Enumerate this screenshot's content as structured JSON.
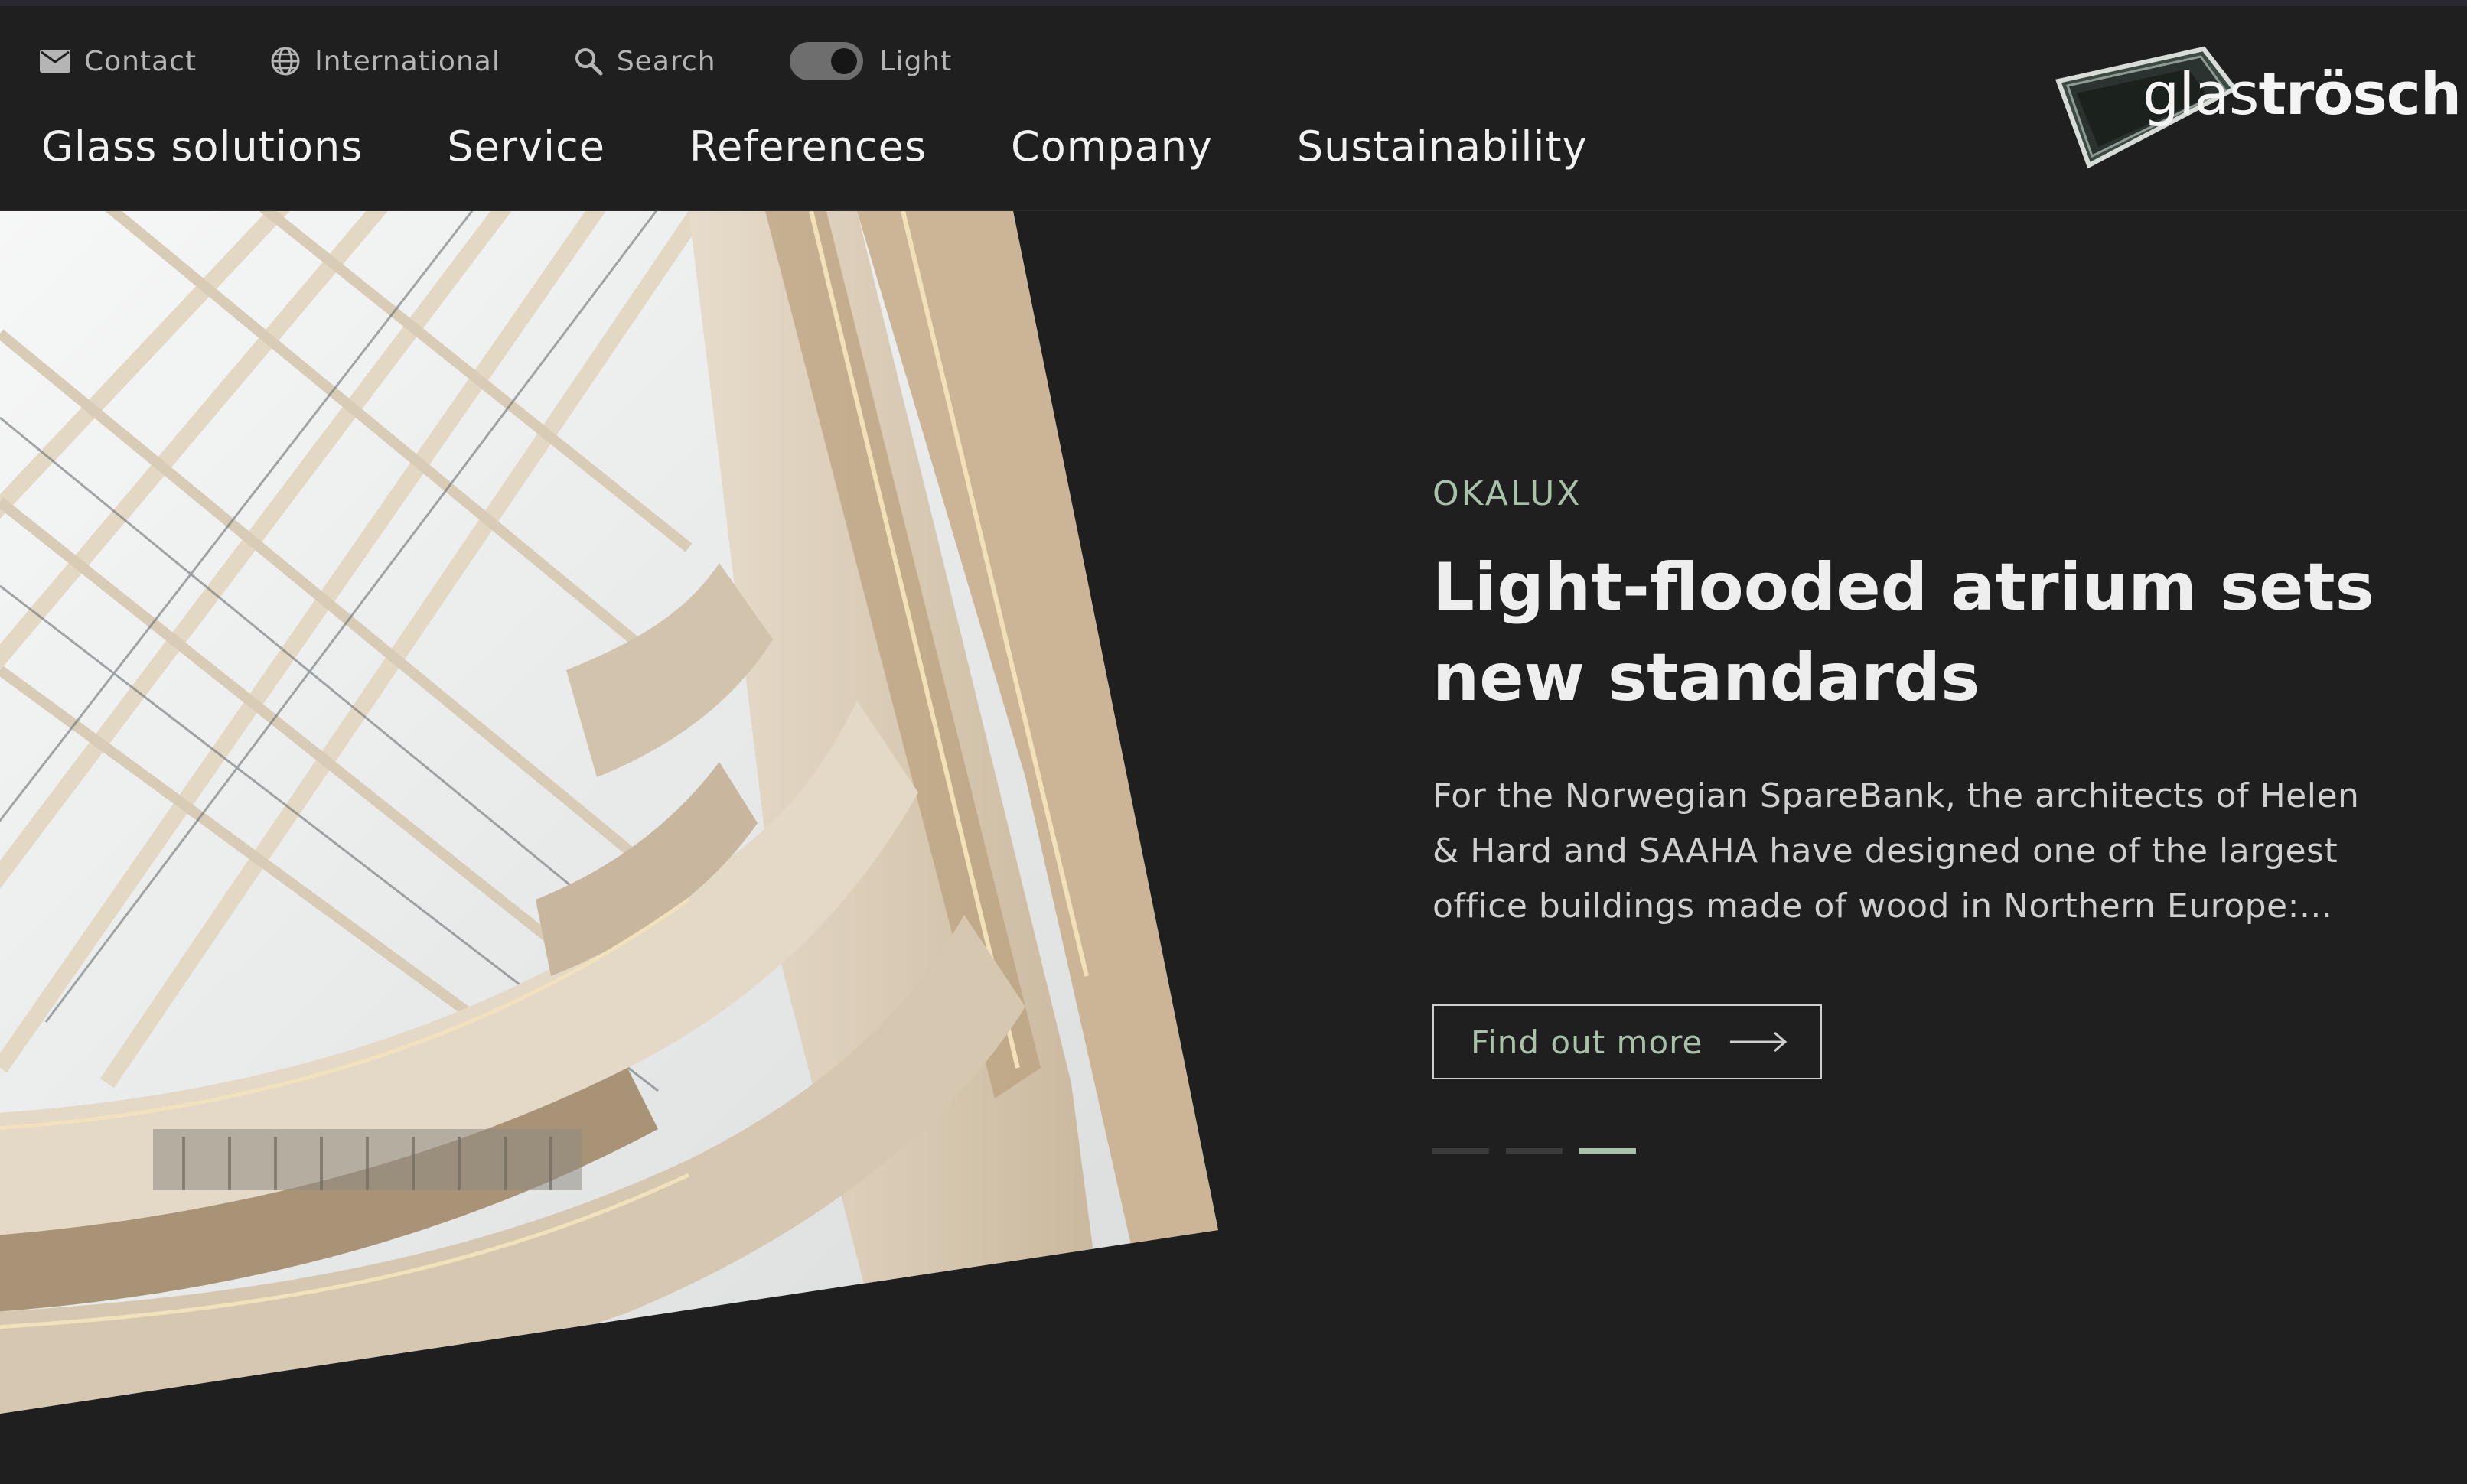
{
  "utility": {
    "contact_label": "Contact",
    "international_label": "International",
    "search_label": "Search",
    "theme_label": "Light"
  },
  "nav": {
    "items": [
      "Glass solutions",
      "Service",
      "References",
      "Company",
      "Sustainability"
    ]
  },
  "logo": {
    "part1": "glas",
    "part2": "trösch"
  },
  "hero": {
    "eyebrow": "OKALUX",
    "headline": "Light-flooded atrium sets new standards",
    "description": "For the Norwegian SpareBank, the architects of Helen & Hard and SAAHA have designed one of the largest office buildings made of wood in Northern Europe:...",
    "cta_label": "Find out more",
    "slides_count": 3,
    "active_slide": 3
  },
  "colors": {
    "background": "#1f1f1f",
    "accent": "#a8c2aa"
  },
  "icons": [
    "mail-icon",
    "globe-icon",
    "search-icon",
    "theme-toggle",
    "arrow-right-icon"
  ]
}
